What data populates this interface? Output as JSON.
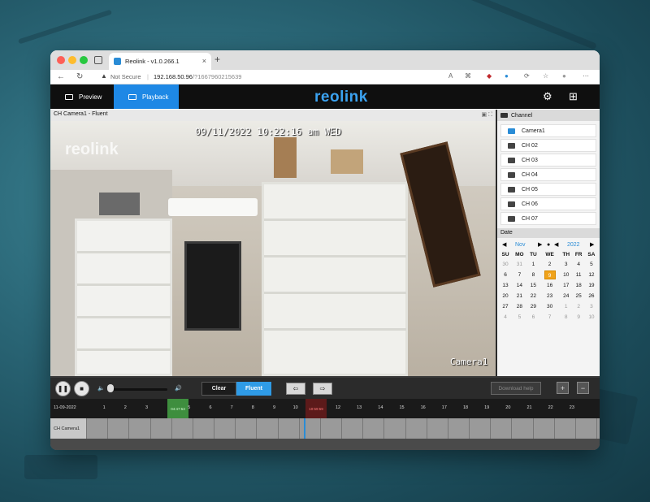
{
  "browser": {
    "tab_title": "Reolink - v1.0.266.1",
    "tab_close": "×",
    "new_tab": "+",
    "security_label": "Not Secure",
    "url_host": "192.168.50.96",
    "url_path": "/?1667960215639",
    "icons": [
      "back-arrow-icon",
      "reload-icon",
      "warning-icon",
      "text-size-icon",
      "translate-icon",
      "extension-icon",
      "extension-icon",
      "extension-icon",
      "bookmark-icon",
      "profile-icon",
      "more-icon"
    ]
  },
  "app": {
    "logo": "reolink",
    "nav": {
      "preview": "Preview",
      "playback": "Playback"
    },
    "accent": "#1e88e5"
  },
  "video": {
    "title": "CH Camera1 - Fluent",
    "osd_time": "09/11/2022 10:22:16 am WED",
    "osd_logo": "reolink",
    "osd_camera": "Camera1"
  },
  "channels": {
    "header": "Channel",
    "items": [
      "Camera1",
      "CH 02",
      "CH 03",
      "CH 04",
      "CH 05",
      "CH 06",
      "CH 07"
    ],
    "active_index": 0
  },
  "calendar": {
    "header": "Date",
    "month": "Nov",
    "year": "2022",
    "weekdays": [
      "SU",
      "MO",
      "TU",
      "WE",
      "TH",
      "FR",
      "SA"
    ],
    "weeks": [
      [
        "30",
        "31",
        "1",
        "2",
        "3",
        "4",
        "5"
      ],
      [
        "6",
        "7",
        "8",
        "9",
        "10",
        "11",
        "12"
      ],
      [
        "13",
        "14",
        "15",
        "16",
        "17",
        "18",
        "19"
      ],
      [
        "20",
        "21",
        "22",
        "23",
        "24",
        "25",
        "26"
      ],
      [
        "27",
        "28",
        "29",
        "30",
        "1",
        "2",
        "3"
      ],
      [
        "4",
        "5",
        "6",
        "7",
        "8",
        "9",
        "10"
      ]
    ],
    "selected_day": "9",
    "selected_color": "#f0a31b"
  },
  "controls": {
    "quality_clear": "Clear",
    "quality_fluent": "Fluent",
    "download": "Download help",
    "zoom_in": "+",
    "zoom_out": "−"
  },
  "timeline": {
    "date": "11-09-2022",
    "hours": [
      "1",
      "2",
      "3",
      "",
      "5",
      "6",
      "7",
      "8",
      "9",
      "10",
      "",
      "12",
      "13",
      "14",
      "15",
      "16",
      "17",
      "18",
      "19",
      "20",
      "21",
      "22",
      "23"
    ],
    "start_marker": "04:47:53",
    "end_marker": "10:59:59",
    "channel_label": "CH Camera1"
  }
}
